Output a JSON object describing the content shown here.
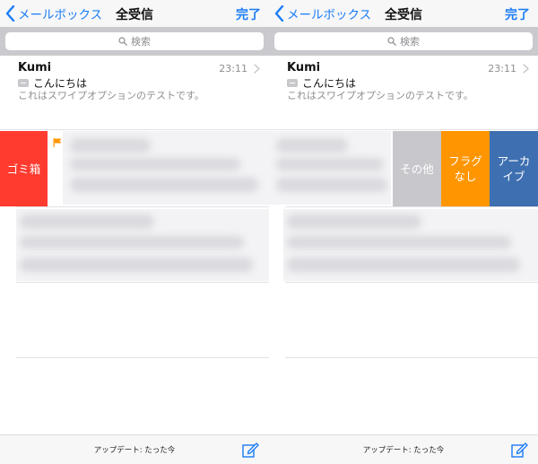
{
  "nav": {
    "back_label": "メールボックス",
    "title": "全受信",
    "done_label": "完了"
  },
  "search": {
    "placeholder": "検索"
  },
  "message": {
    "sender": "Kumi",
    "time": "23:11",
    "subject": "こんにちは",
    "preview": "これはスワイプオプションのテストです。"
  },
  "swipe_left": {
    "trash_label": "ゴミ箱"
  },
  "swipe_right": {
    "more_label": "その他",
    "flag_label": "フラグ\nなし",
    "archive_label": "アーカ\nイブ"
  },
  "toolbar": {
    "status": "アップデート: たった今"
  },
  "colors": {
    "accent": "#1a7cf6",
    "trash": "#ff3b30",
    "flag": "#ff9500",
    "archive": "#3e6fb0",
    "more": "#c7c7cc"
  },
  "icons": {
    "back": "chevron-left-icon",
    "search": "magnifier-icon",
    "disclosure": "chevron-right-icon",
    "flag": "flag-icon",
    "compose": "compose-icon"
  }
}
